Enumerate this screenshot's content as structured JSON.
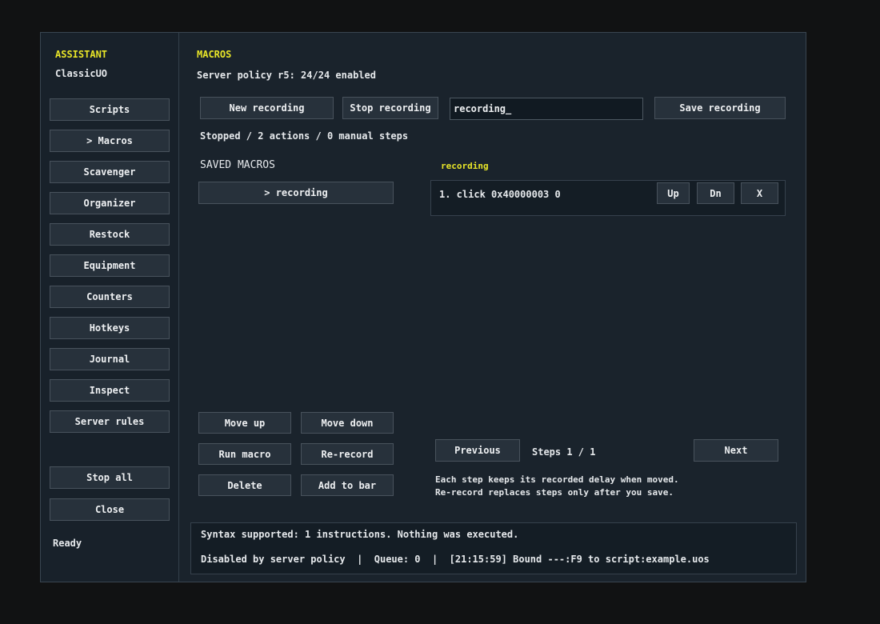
{
  "sidebar": {
    "title": "ASSISTANT",
    "subtitle": "ClassicUO",
    "items": [
      {
        "label": "Scripts"
      },
      {
        "label": "> Macros"
      },
      {
        "label": "Scavenger"
      },
      {
        "label": "Organizer"
      },
      {
        "label": "Restock"
      },
      {
        "label": "Equipment"
      },
      {
        "label": "Counters"
      },
      {
        "label": "Hotkeys"
      },
      {
        "label": "Journal"
      },
      {
        "label": "Inspect"
      },
      {
        "label": "Server rules"
      }
    ],
    "stop_all_label": "Stop all",
    "close_label": "Close",
    "status": "Ready"
  },
  "main": {
    "title": "MACROS",
    "policy": "Server policy r5: 24/24 enabled",
    "new_recording_label": "New recording",
    "stop_recording_label": "Stop recording",
    "recording_name_value": "recording_",
    "save_recording_label": "Save recording",
    "recording_status": "Stopped / 2 actions / 0 manual steps",
    "saved_macros_heading": "SAVED MACROS",
    "saved_macros": [
      {
        "label": "> recording"
      }
    ],
    "selected_macro_name": "recording",
    "steps": [
      {
        "text": "1. click 0x40000003 0",
        "up_label": "Up",
        "down_label": "Dn",
        "delete_label": "X"
      }
    ],
    "move_up_label": "Move up",
    "move_down_label": "Move down",
    "run_macro_label": "Run macro",
    "rerecord_label": "Re-record",
    "delete_label": "Delete",
    "add_to_bar_label": "Add to bar",
    "previous_label": "Previous",
    "steps_page": "Steps 1 / 1",
    "next_label": "Next",
    "note_line1": "Each step keeps its recorded delay when moved.",
    "note_line2": "Re-record replaces steps only after you save."
  },
  "status_bar": {
    "line1": "Syntax supported: 1 instructions. Nothing was executed.",
    "line2": "Disabled by server policy  |  Queue: 0  |  [21:15:59] Bound ---:F9 to script:example.uos"
  },
  "colors": {
    "accent": "#e9e628",
    "background": "#1a232c",
    "button": "#27313b"
  }
}
